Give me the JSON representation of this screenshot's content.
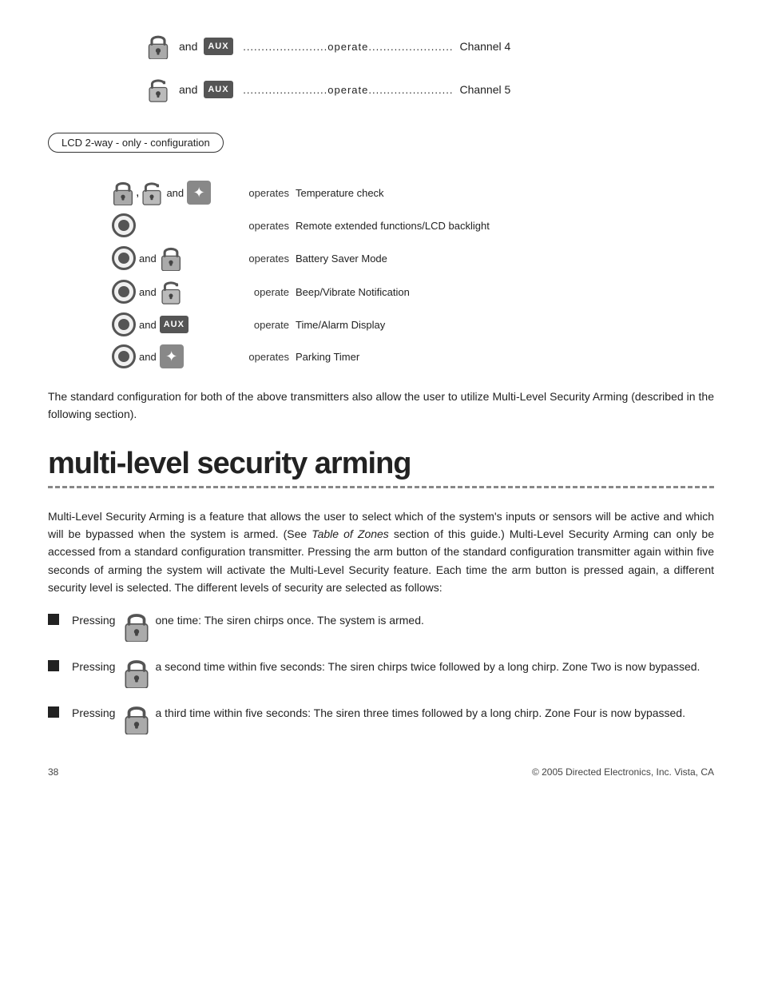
{
  "channels": [
    {
      "id": "channel4",
      "lock_type": "locked",
      "and": "and",
      "dots": "......................operate......................",
      "label": "Channel 4"
    },
    {
      "id": "channel5",
      "lock_type": "unlocked",
      "and": "and",
      "dots": "......................operate......................",
      "label": "Channel 5"
    }
  ],
  "lcd_config_label": "LCD 2-way - only - configuration",
  "lcd_rows": [
    {
      "icons": [
        "lock_locked",
        "comma",
        "lock_unlocked",
        "and",
        "star"
      ],
      "operates": "operates",
      "function": "Temperature check"
    },
    {
      "icons": [
        "circle"
      ],
      "operates": "operates",
      "function": "Remote extended functions/LCD backlight"
    },
    {
      "icons": [
        "circle",
        "and",
        "lock_locked"
      ],
      "operates": "operates",
      "function": "Battery Saver Mode"
    },
    {
      "icons": [
        "circle",
        "and",
        "lock_unlocked"
      ],
      "operates": "operate",
      "function": "Beep/Vibrate Notification"
    },
    {
      "icons": [
        "circle",
        "and",
        "aux"
      ],
      "operates": "operate",
      "function": "Time/Alarm Display"
    },
    {
      "icons": [
        "circle",
        "and",
        "star"
      ],
      "operates": "operates",
      "function": "Parking Timer"
    }
  ],
  "standard_config_paragraph": "The standard configuration for both of the above transmitters also allow the user to utilize Multi-Level Security Arming (described in the following section).",
  "section_title": "multi-level security arming",
  "body_paragraph": "Multi-Level Security Arming is a feature that allows the user to select which of the system's inputs or sensors will be active and which will be bypassed when the system is armed. (See Table of Zones section of this guide.) Multi-Level Security Arming can only be accessed from a standard configuration transmitter. Pressing the arm button of the standard configuration transmitter again within five seconds of arming the system will activate the Multi-Level Security feature. Each time the arm button is pressed again, a different security level is selected. The different levels of security are selected as follows:",
  "bullets": [
    {
      "pressing": "Pressing",
      "lock": "locked",
      "text": "one time: The siren chirps once. The system is armed."
    },
    {
      "pressing": "Pressing",
      "lock": "locked",
      "text": "a second time within five seconds: The siren chirps twice followed by a long chirp. Zone Two is now bypassed."
    },
    {
      "pressing": "Pressing",
      "lock": "locked",
      "text": "a third time within five seconds: The siren three times followed by a long chirp. Zone Four is now bypassed."
    }
  ],
  "footer": {
    "page_number": "38",
    "copyright": "© 2005 Directed Electronics, Inc. Vista, CA"
  }
}
